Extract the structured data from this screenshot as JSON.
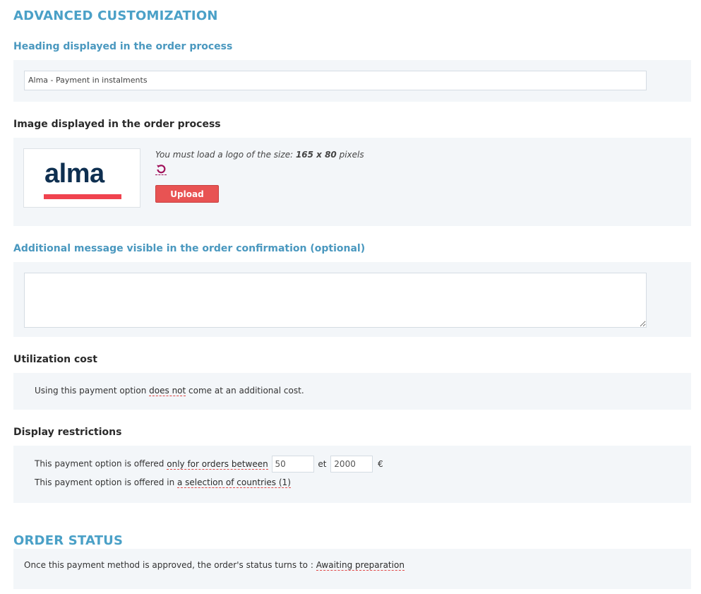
{
  "advanced": {
    "title": "ADVANCED CUSTOMIZATION",
    "heading_label": "Heading displayed in the order process",
    "heading_value": "Alma - Payment in instalments",
    "image_label": "Image displayed in the order process",
    "logo_text": "alma",
    "hint_prefix": "You must load a logo of the size: ",
    "hint_size": "165 x 80",
    "hint_suffix": " pixels",
    "upload_label": "Upload",
    "message_label": "Additional message visible in the order confirmation (optional)",
    "message_value": ""
  },
  "cost": {
    "label": "Utilization cost",
    "prefix": "Using this payment option ",
    "link": "does not",
    "suffix": " come at an additional cost."
  },
  "restrictions": {
    "label": "Display restrictions",
    "line1_prefix": "This payment option is offered ",
    "line1_link": "only for orders between",
    "min": "50",
    "between": "et",
    "max": "2000",
    "currency": "€",
    "line2_prefix": "This payment option is offered in ",
    "line2_link": "a selection of countries (1)"
  },
  "order_status": {
    "title": "ORDER STATUS",
    "prefix": "Once this payment method is approved, the order's status turns to : ",
    "link": "Awaiting preparation"
  },
  "colors": {
    "section_title": "#4aa0c7",
    "label_blue": "#4a98bf",
    "upload_button": "#e85353",
    "logo_text": "#0e2f50",
    "logo_bar": "#f0434f",
    "panel": "#f3f6f9"
  }
}
